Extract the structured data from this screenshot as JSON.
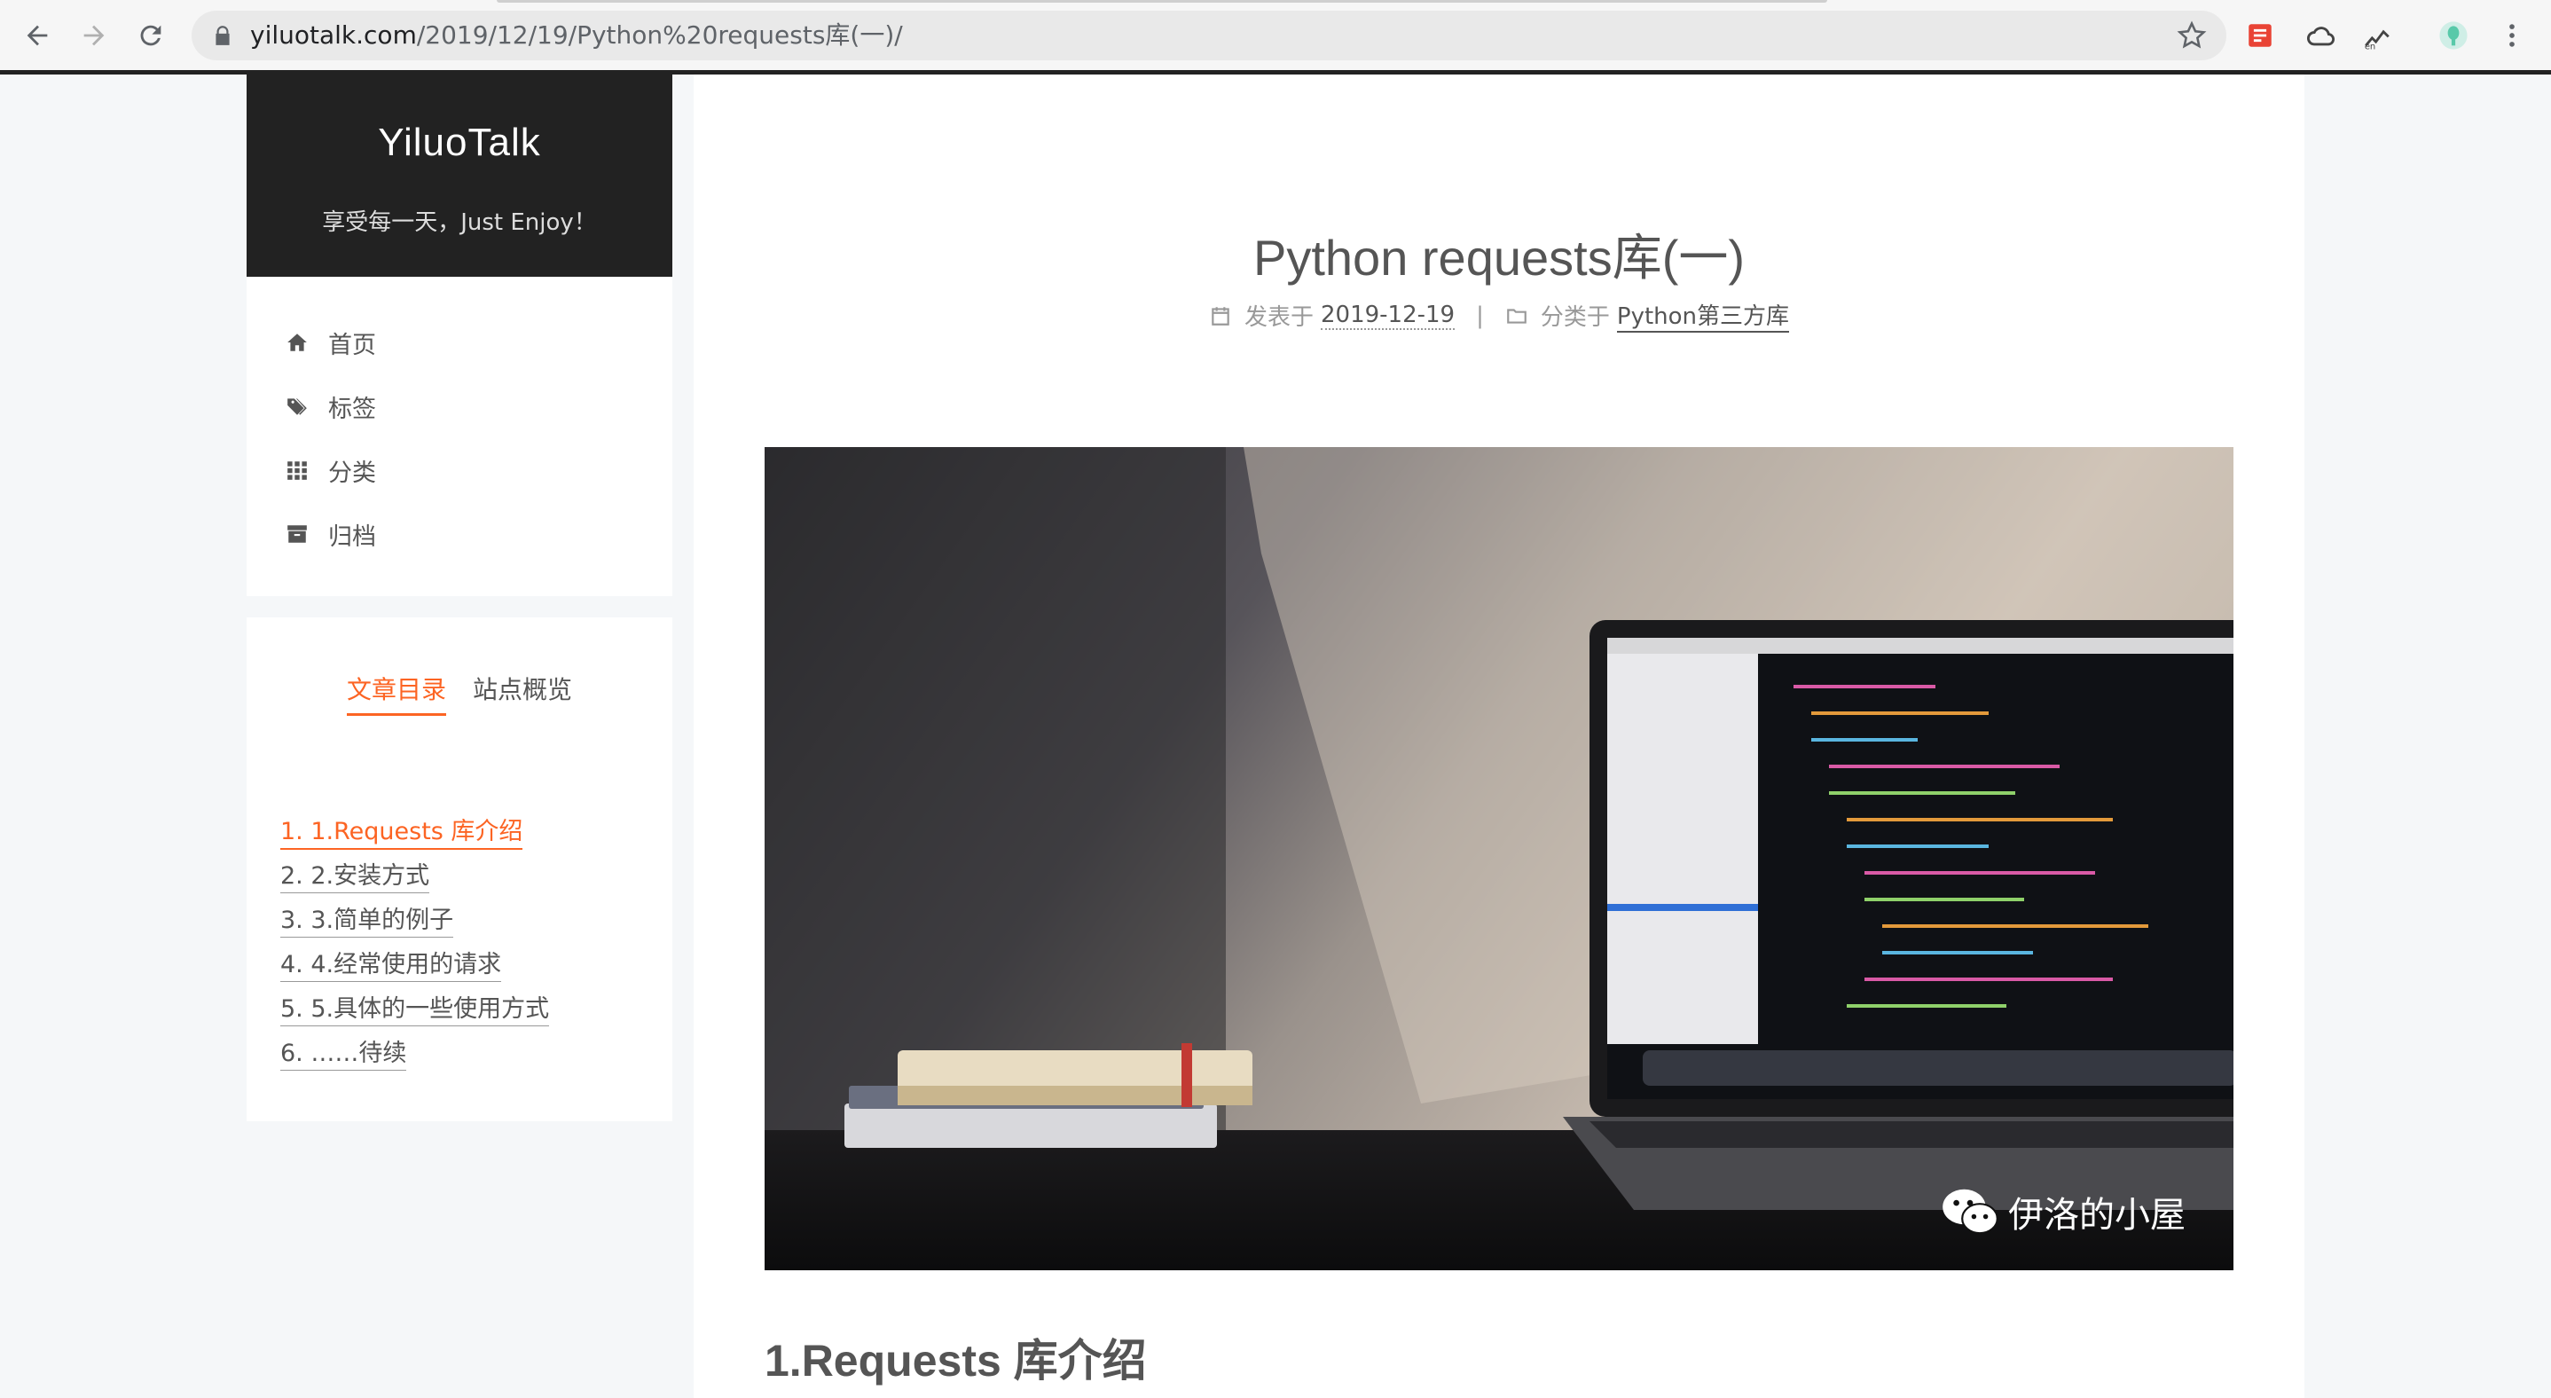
{
  "browser": {
    "url_host": "yiluotalk.com",
    "url_path": "/2019/12/19/Python%20requests库(一)/"
  },
  "site": {
    "title": "YiluoTalk",
    "subtitle": "享受每一天，Just Enjoy！"
  },
  "menu": {
    "items": [
      {
        "label": "首页",
        "icon": "home-icon"
      },
      {
        "label": "标签",
        "icon": "tags-icon"
      },
      {
        "label": "分类",
        "icon": "grid-icon"
      },
      {
        "label": "归档",
        "icon": "archive-icon"
      }
    ]
  },
  "sidebar_tabs": {
    "toc": "文章目录",
    "overview": "站点概览"
  },
  "toc": {
    "items": [
      "1. 1.Requests 库介绍",
      "2. 2.安装方式",
      "3. 3.简单的例子",
      "4. 4.经常使用的请求",
      "5. 5.具体的一些使用方式",
      "6. ……待续"
    ]
  },
  "post": {
    "title": "Python requests库(一)",
    "posted_label": "发表于",
    "date": "2019-12-19",
    "separator": "|",
    "category_label": "分类于",
    "category": "Python第三方库",
    "image_watermark": "伊洛的小屋",
    "first_heading": "1.Requests 库介绍"
  },
  "colors": {
    "accent": "#fc6423",
    "brand_bg": "#222222",
    "page_bg": "#f5f7f9"
  }
}
